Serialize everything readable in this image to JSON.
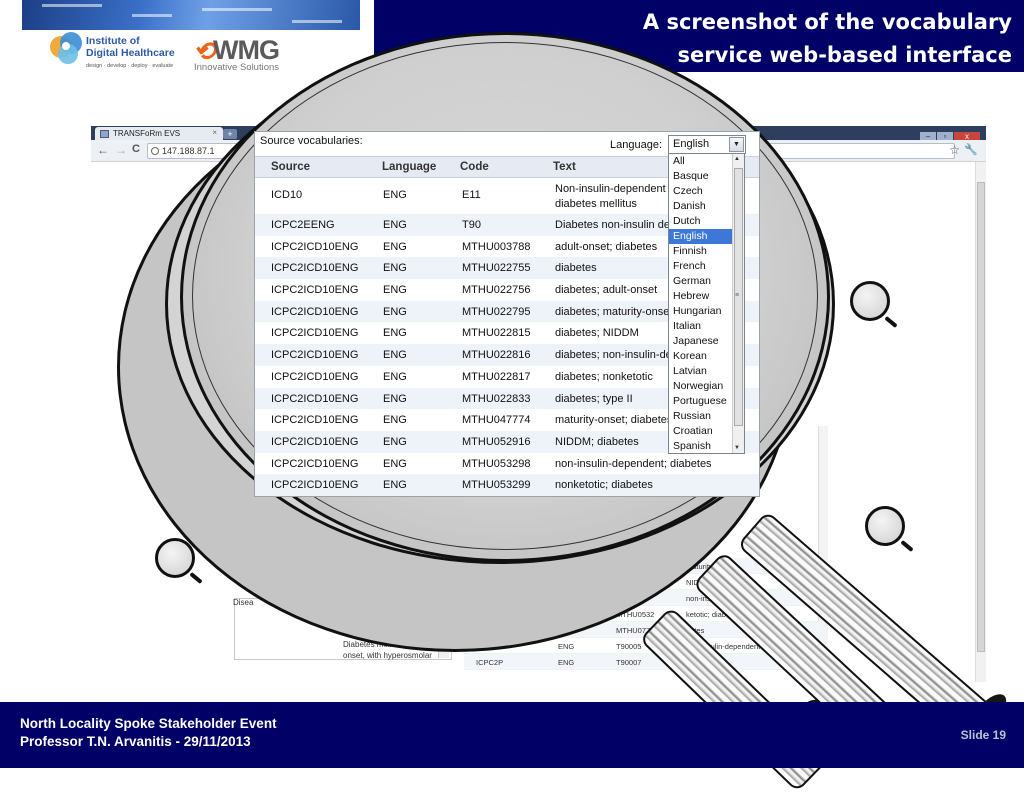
{
  "slide": {
    "title_line1": "A screenshot of the vocabulary",
    "title_line2": "service web-based interface",
    "logo_ihd_line1": "Institute of",
    "logo_ihd_line2": "Digital Healthcare",
    "logo_ihd_tagline": "design · develop · deploy · evaluate",
    "logo_wmg_text": "WMG",
    "logo_wmg_tagline": "Innovative Solutions",
    "footer_line1": "North Locality Spoke Stakeholder Event",
    "footer_line2": "Professor T.N. Arvanitis  - 29/11/2013",
    "slide_number": "Slide 19",
    "colors": {
      "header_bg": "#000066",
      "footer_bg": "#000066",
      "selected_option": "#3d78d8"
    }
  },
  "browser": {
    "tab_title": "TRANSFoRm EVS",
    "tab_close": "×",
    "new_tab": "+",
    "address": "147.188.87.1",
    "back_icon": "←",
    "forward_icon": "→",
    "reload_icon": "C",
    "star_icon": "☆",
    "wrench_icon": "🔧"
  },
  "background_content": {
    "side_label": "Disea",
    "side_text": "Diabetes mellitus, adult onset, with hyperosmolar",
    "rows": [
      {
        "source": "",
        "language": "",
        "code": "",
        "text": "maturity-o"
      },
      {
        "source": "",
        "language": "",
        "code": "",
        "text": "NIDDM; diabete"
      },
      {
        "source": "",
        "language": "",
        "code": "MTHU0",
        "text": "non-insulin-depende"
      },
      {
        "source": "",
        "language": "",
        "code": "MTHU0532",
        "text": "ketotic; diabetes"
      },
      {
        "source": "ICPC2ICD10ENG",
        "language": "ENG",
        "code": "MTHU077306",
        "text": "betes"
      },
      {
        "source": "ICPC2P",
        "language": "ENG",
        "code": "T90005",
        "text": "non-insulin-dependent diabetes"
      },
      {
        "source": "ICPC2P",
        "language": "ENG",
        "code": "T90007",
        "text": "adult ons"
      }
    ]
  },
  "zoom": {
    "source_label": "Source vocabularies:",
    "language_label": "Language:",
    "language_selected": "English",
    "columns": [
      "Source",
      "Language",
      "Code",
      "Text"
    ],
    "rows": [
      {
        "source": "ICD10",
        "language": "ENG",
        "code": "E11",
        "text": "Non-insulin-dependent diabetes mellitus"
      },
      {
        "source": "ICPC2EENG",
        "language": "ENG",
        "code": "T90",
        "text": "Diabetes non-insulin dependent"
      },
      {
        "source": "ICPC2ICD10ENG",
        "language": "ENG",
        "code": "MTHU003788",
        "text": "adult-onset; diabetes"
      },
      {
        "source": "ICPC2ICD10ENG",
        "language": "ENG",
        "code": "MTHU022755",
        "text": "diabetes"
      },
      {
        "source": "ICPC2ICD10ENG",
        "language": "ENG",
        "code": "MTHU022756",
        "text": "diabetes; adult-onset"
      },
      {
        "source": "ICPC2ICD10ENG",
        "language": "ENG",
        "code": "MTHU022795",
        "text": "diabetes; maturity-onset"
      },
      {
        "source": "ICPC2ICD10ENG",
        "language": "ENG",
        "code": "MTHU022815",
        "text": "diabetes; NIDDM"
      },
      {
        "source": "ICPC2ICD10ENG",
        "language": "ENG",
        "code": "MTHU022816",
        "text": "diabetes; non-insulin-dependent"
      },
      {
        "source": "ICPC2ICD10ENG",
        "language": "ENG",
        "code": "MTHU022817",
        "text": "diabetes; nonketotic"
      },
      {
        "source": "ICPC2ICD10ENG",
        "language": "ENG",
        "code": "MTHU022833",
        "text": "diabetes; type II"
      },
      {
        "source": "ICPC2ICD10ENG",
        "language": "ENG",
        "code": "MTHU047774",
        "text": "maturity-onset; diabetes"
      },
      {
        "source": "ICPC2ICD10ENG",
        "language": "ENG",
        "code": "MTHU052916",
        "text": "NIDDM; diabetes"
      },
      {
        "source": "ICPC2ICD10ENG",
        "language": "ENG",
        "code": "MTHU053298",
        "text": "non-insulin-dependent; diabetes"
      },
      {
        "source": "ICPC2ICD10ENG",
        "language": "ENG",
        "code": "MTHU053299",
        "text": "nonketotic; diabetes"
      }
    ],
    "language_options": [
      "All",
      "Basque",
      "Czech",
      "Danish",
      "Dutch",
      "English",
      "Finnish",
      "French",
      "German",
      "Hebrew",
      "Hungarian",
      "Italian",
      "Japanese",
      "Korean",
      "Latvian",
      "Norwegian",
      "Portuguese",
      "Russian",
      "Croatian",
      "Spanish"
    ],
    "scroll_up": "▲",
    "scroll_down": "▼",
    "scroll_grip": "≡",
    "select_arrow": "▼"
  }
}
